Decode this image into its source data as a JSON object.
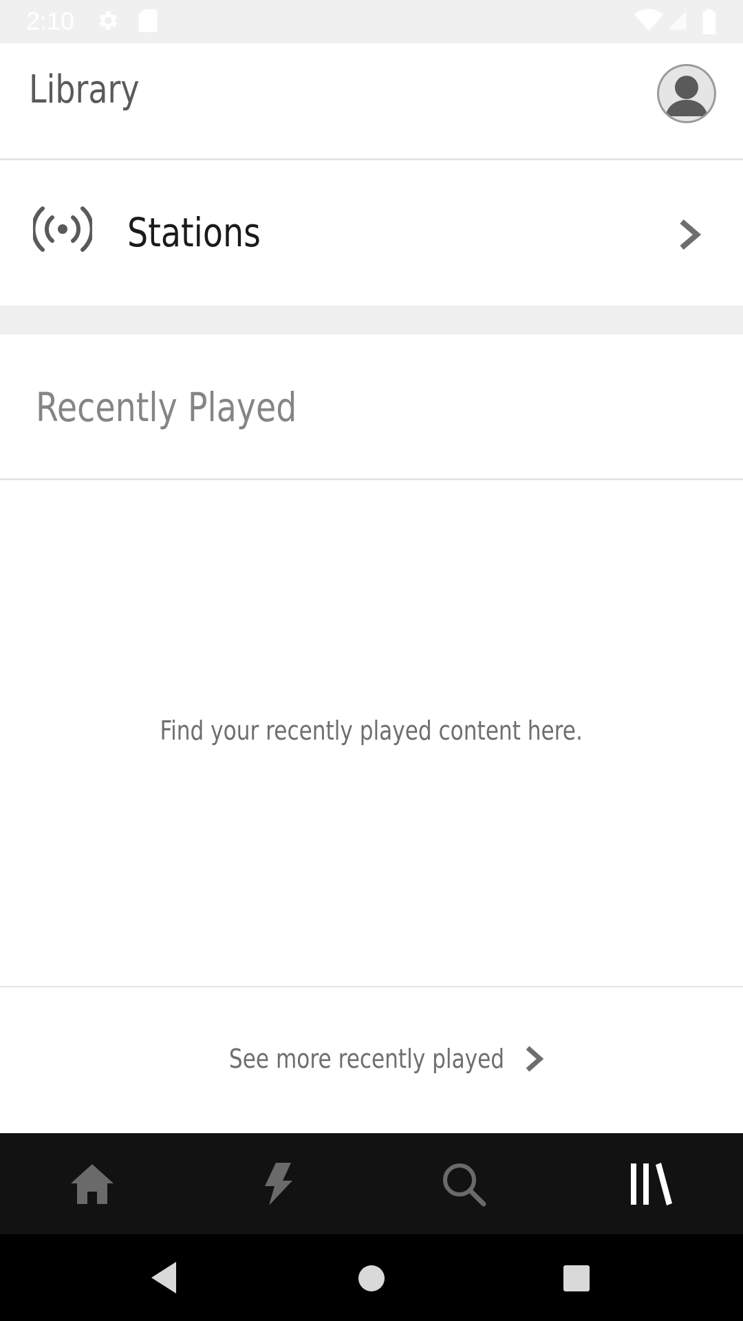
{
  "status_bar": {
    "time": "2:10",
    "icons": [
      "gear-icon",
      "sd-card-icon",
      "wifi-icon",
      "signal-icon",
      "battery-icon"
    ]
  },
  "header": {
    "title": "Library",
    "avatar_icon": "person-icon"
  },
  "stations": {
    "label": "Stations",
    "icon": "radio-broadcast-icon",
    "chevron": "chevron-right-icon"
  },
  "recently_played": {
    "title": "Recently Played",
    "empty_message": "Find your recently played content here.",
    "see_more_label": "See more recently played"
  },
  "bottom_nav": {
    "items": [
      {
        "name": "home",
        "icon": "home-icon",
        "active": false
      },
      {
        "name": "for-you",
        "icon": "lightning-icon",
        "active": false
      },
      {
        "name": "search",
        "icon": "search-icon",
        "active": false
      },
      {
        "name": "library",
        "icon": "library-icon",
        "active": true
      }
    ]
  },
  "colors": {
    "nav_background": "#121212",
    "nav_icon_inactive": "#6a6a6a",
    "nav_icon_active": "#ffffff",
    "section_gap": "#efefef"
  }
}
